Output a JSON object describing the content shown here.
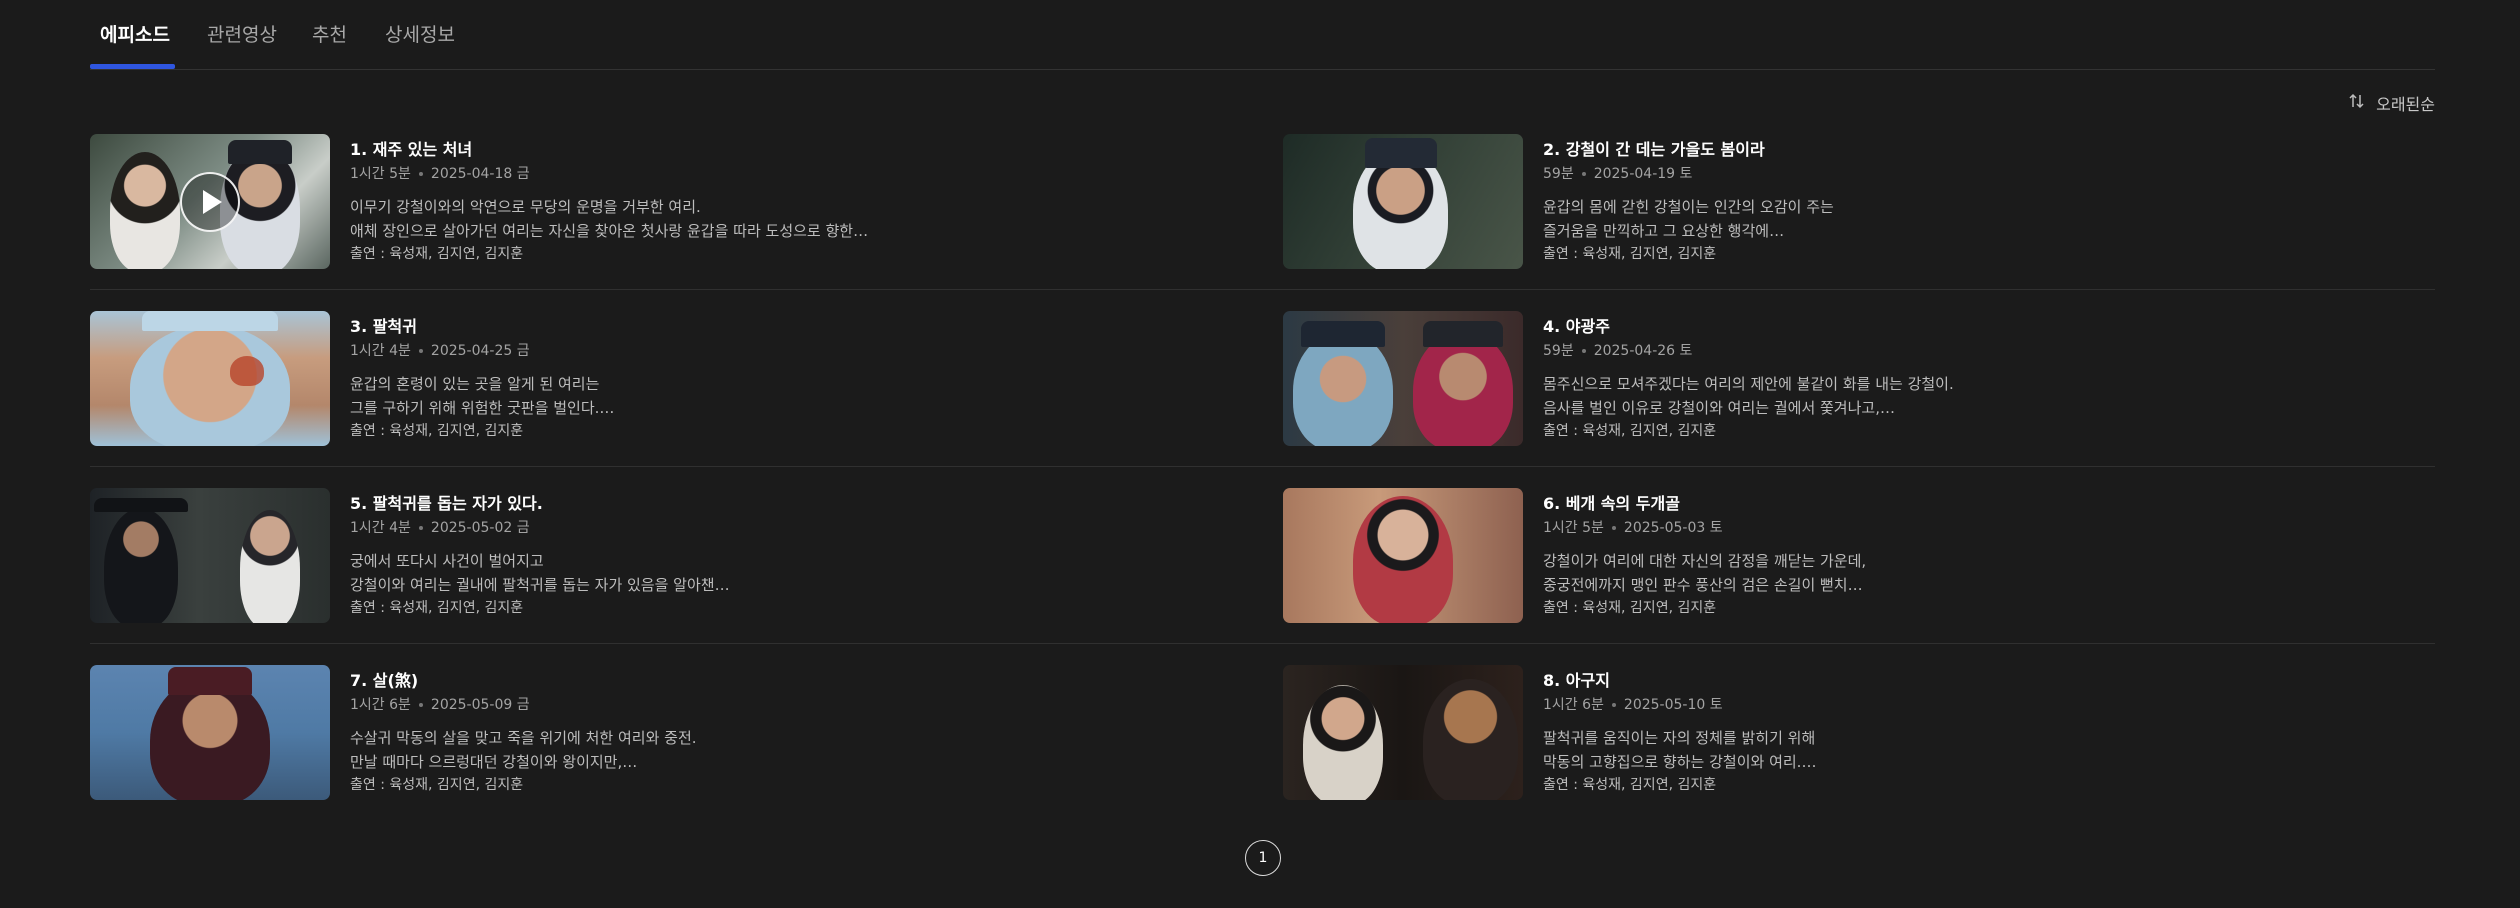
{
  "tabs": [
    {
      "label": "에피소드"
    },
    {
      "label": "관련영상"
    },
    {
      "label": "추천"
    },
    {
      "label": "상세정보"
    }
  ],
  "sort": {
    "label": "오래된순"
  },
  "cast_prefix": "출연 : ",
  "episodes": [
    {
      "title": "1. 재주 있는 처녀",
      "duration": "1시간 5분",
      "date": "2025-04-18 금",
      "desc1": "이무기 강철이와의 악연으로 무당의 운명을 거부한 여리.",
      "desc2": "애체 장인으로 살아가던 여리는 자신을 찾아온 첫사랑 윤갑을 따라 도성으로 향한…",
      "cast": "육성재, 김지연, 김지훈"
    },
    {
      "title": "2. 강철이 간 데는 가을도 봄이라",
      "duration": "59분",
      "date": "2025-04-19 토",
      "desc1": "윤갑의 몸에 갇힌 강철이는 인간의 오감이 주는",
      "desc2": "즐거움을 만끽하고 그 요상한 행각에…",
      "cast": "육성재, 김지연, 김지훈"
    },
    {
      "title": "3. 팔척귀",
      "duration": "1시간 4분",
      "date": "2025-04-25 금",
      "desc1": "윤갑의 혼령이 있는 곳을 알게 된 여리는",
      "desc2": "그를 구하기 위해 위험한 굿판을 벌인다.…",
      "cast": "육성재, 김지연, 김지훈"
    },
    {
      "title": "4. 야광주",
      "duration": "59분",
      "date": "2025-04-26 토",
      "desc1": "몸주신으로 모셔주겠다는 여리의 제안에 불같이 화를 내는 강철이.",
      "desc2": "음사를 벌인 이유로 강철이와 여리는 궐에서 쫓겨나고,…",
      "cast": "육성재, 김지연, 김지훈"
    },
    {
      "title": "5. 팔척귀를 돕는 자가 있다.",
      "duration": "1시간 4분",
      "date": "2025-05-02 금",
      "desc1": "궁에서 또다시 사건이 벌어지고",
      "desc2": "강철이와 여리는 궐내에 팔척귀를 돕는 자가 있음을 알아챈…",
      "cast": "육성재, 김지연, 김지훈"
    },
    {
      "title": "6. 베개 속의 두개골",
      "duration": "1시간 5분",
      "date": "2025-05-03 토",
      "desc1": "강철이가 여리에 대한 자신의 감정을 깨닫는 가운데,",
      "desc2": "중궁전에까지 맹인 판수 풍산의 검은 손길이 뻗치…",
      "cast": "육성재, 김지연, 김지훈"
    },
    {
      "title": "7. 살(煞)",
      "duration": "1시간 6분",
      "date": "2025-05-09 금",
      "desc1": "수살귀 막동의 살을 맞고 죽을 위기에 처한 여리와 중전.",
      "desc2": "만날 때마다 으르렁대던 강철이와 왕이지만,…",
      "cast": "육성재, 김지연, 김지훈"
    },
    {
      "title": "8. 아구지",
      "duration": "1시간 6분",
      "date": "2025-05-10 토",
      "desc1": "팔척귀를 움직이는 자의 정체를 밝히기 위해",
      "desc2": "막동의 고향집으로 향하는 강철이와 여리.…",
      "cast": "육성재, 김지연, 김지훈"
    }
  ],
  "pagination": {
    "current": "1"
  },
  "colors": {
    "background": "#1b1b1b",
    "accent": "#2f56e0"
  }
}
